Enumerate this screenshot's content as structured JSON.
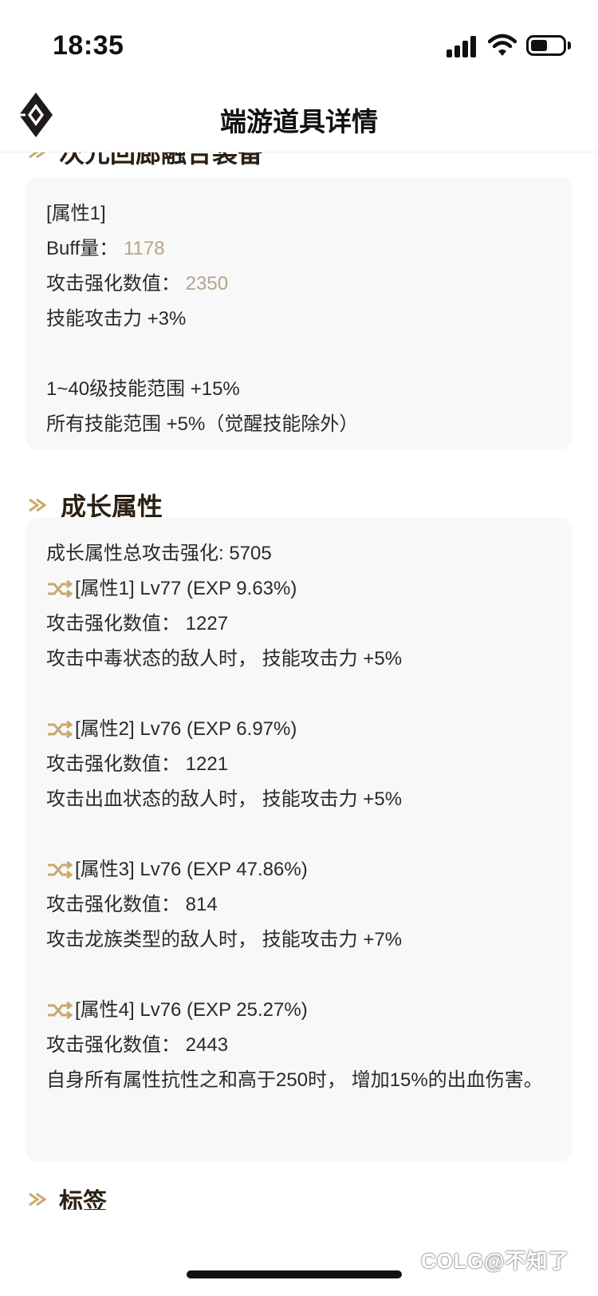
{
  "status_bar": {
    "time": "18:35"
  },
  "nav": {
    "title": "端游道具详情"
  },
  "clipped_heading": "次元回廊融合装备",
  "attr_card": {
    "header": "[属性1]",
    "buff_label": "Buff量：",
    "buff_value": "1178",
    "atk_label": "攻击强化数值：",
    "atk_value": "2350",
    "skill_atk": "技能攻击力 +3%",
    "range_1_40": "1~40级技能范围 +15%",
    "range_all": "所有技能范围 +5%（觉醒技能除外）"
  },
  "growth": {
    "heading": "成长属性",
    "total": "成长属性总攻击强化: 5705",
    "props": [
      {
        "title": "[属性1] Lv77 (EXP 9.63%)",
        "atk": "攻击强化数值： 1227",
        "effect": "攻击中毒状态的敌人时， 技能攻击力 +5%"
      },
      {
        "title": "[属性2] Lv76 (EXP 6.97%)",
        "atk": "攻击强化数值： 1221",
        "effect": "攻击出血状态的敌人时， 技能攻击力 +5%"
      },
      {
        "title": "[属性3] Lv76 (EXP 47.86%)",
        "atk": "攻击强化数值： 814",
        "effect": "攻击龙族类型的敌人时， 技能攻击力 +7%"
      },
      {
        "title": "[属性4] Lv76 (EXP 25.27%)",
        "atk": "攻击强化数值： 2443",
        "effect": "自身所有属性抗性之和高于250时， 增加15%的出血伤害。"
      }
    ]
  },
  "bottom_heading": "标签",
  "watermark": "COLG@不知了",
  "colors": {
    "accent_gold": "#c9a96e",
    "value_gold": "#b5a48a",
    "card_bg": "#f8f8f8",
    "heading": "#2b2015"
  },
  "icons": {
    "arrow": "double-chevron-arrow-icon",
    "shuffle": "shuffle-icon",
    "logo": "diamond-logo-icon"
  }
}
